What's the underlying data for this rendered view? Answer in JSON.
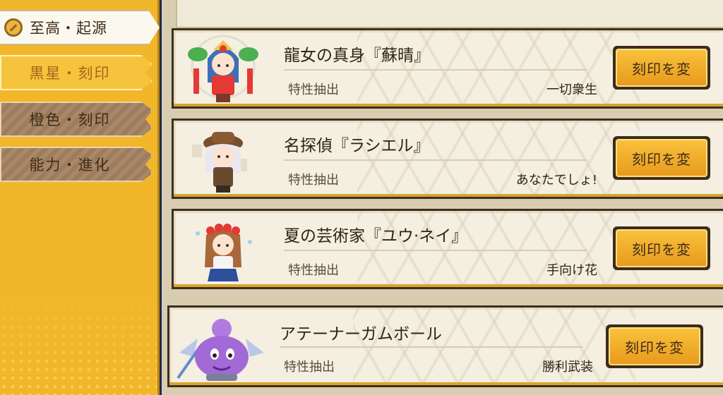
{
  "sidebar": {
    "top_tab": "至高・起源",
    "tabs": [
      {
        "label": "黒星・刻印",
        "active": true
      },
      {
        "label": "橙色・刻印",
        "active": false
      },
      {
        "label": "能力・進化",
        "active": false
      }
    ]
  },
  "cards": [
    {
      "name": "龍女の真身『蘇晴』",
      "stat_label": "特性抽出",
      "stat_value": "一切衆生",
      "button": "刻印を変",
      "avatar_icon": "dragon-maiden-avatar"
    },
    {
      "name": "名探偵『ラシエル』",
      "stat_label": "特性抽出",
      "stat_value": "あなたでしょ!",
      "button": "刻印を変",
      "avatar_icon": "detective-avatar"
    },
    {
      "name": "夏の芸術家『ユウ·ネイ』",
      "stat_label": "特性抽出",
      "stat_value": "手向け花",
      "button": "刻印を変",
      "avatar_icon": "artist-avatar"
    },
    {
      "name": "アテーナーガムボール",
      "stat_label": "特性抽出",
      "stat_value": "勝利武装",
      "button": "刻印を変",
      "avatar_icon": "gumball-slime-avatar"
    }
  ],
  "colors": {
    "sidebar": "#f2b62a",
    "active_tab_text": "#a8641a",
    "button": "#f2ac2a",
    "card_bg": "#f4efe1"
  }
}
